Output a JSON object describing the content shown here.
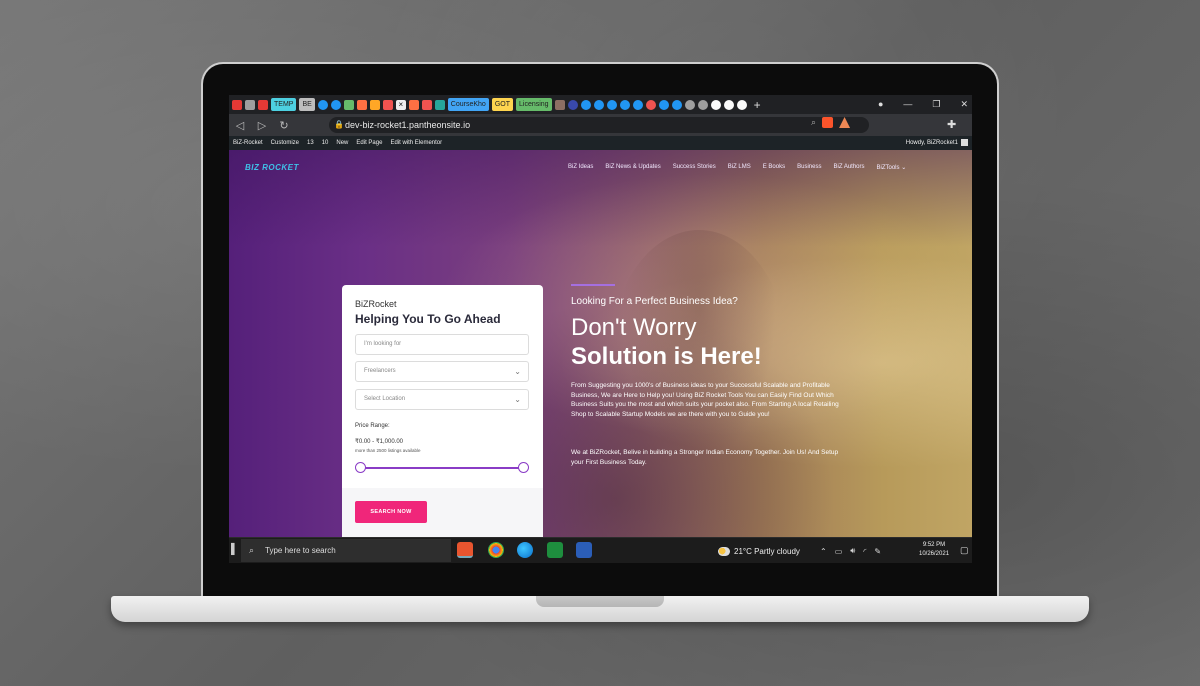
{
  "browser": {
    "tabs": [
      {
        "label": "TEMP",
        "color": "#4dd0e1"
      },
      {
        "label": "BE",
        "color": "#bdbdbd"
      },
      {
        "label": "CourseKho",
        "color": "#42a5f5"
      },
      {
        "label": "GOT",
        "color": "#ffd54f"
      },
      {
        "label": "Licensing",
        "color": "#66bb6a"
      }
    ],
    "new_tab_glyph": "+",
    "address": "dev-biz-rocket1.pantheonsite.io"
  },
  "wp_admin_bar": {
    "items": [
      "BiZ-Rocket",
      "Customize",
      "13",
      "10",
      "New",
      "Edit Page",
      "Edit with Elementor"
    ],
    "howdy": "Howdy, BiZRocket1"
  },
  "site": {
    "logo": "BIZ ROCKET",
    "menu": [
      "BiZ Ideas",
      "BiZ News & Updates",
      "Success Stories",
      "BiZ LMS",
      "E Books",
      "Business",
      "BiZ Authors",
      "BiZTools"
    ],
    "menu_dropdown_glyph": "⌄"
  },
  "search_card": {
    "eyebrow": "BiZRocket",
    "heading": "Helping You To Go Ahead",
    "keyword_placeholder": "I'm looking for",
    "category_value": "Freelancers",
    "location_value": "Select Location",
    "price_label": "Price Range:",
    "price_range": "₹0.00 - ₹1,000.00",
    "price_note": "more than 2500 listings available",
    "slider_min_fraction": 0,
    "slider_max_fraction": 1,
    "search_button": "SEARCH NOW"
  },
  "hero": {
    "tagline": "Looking For a Perfect Business Idea?",
    "headline_line1": "Don't Worry",
    "headline_line2": "Solution is Here!",
    "paragraph1": "From Suggesting you 1000's of Business ideas to your Successful Scalable and Profitable Business, We are Here to Help you! Using BiZ Rocket Tools You can Easily Find Out Which Business Suits you the most and which suits your pocket also. From Starting A local Retailing Shop to Scalable Startup Models we are there with you to Guide you!",
    "paragraph2": "We at BiZRocket, Belive in building a Stronger Indian Economy Together. Join Us! And Setup your First Business Today."
  },
  "taskbar": {
    "search_placeholder": "Type here to search",
    "weather": "21°C  Partly cloudy",
    "time": "9:52 PM",
    "date": "10/26/2021"
  },
  "colors": {
    "accent_pink": "#f0267a",
    "accent_purple": "#8a3cc6",
    "logo_blue": "#3fc1e8"
  }
}
